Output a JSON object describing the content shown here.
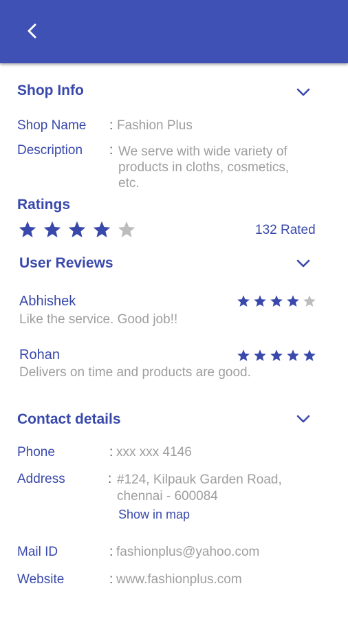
{
  "colors": {
    "primary": "#3f51b5",
    "label": "#3949ab",
    "value_gray": "#9e9e9e",
    "star_filled": "#3949ab",
    "star_empty": "#bdbdbd"
  },
  "icons": {
    "back": "chevron-left-icon",
    "collapse": "chevron-down-icon",
    "star": "star-icon"
  },
  "shop_info": {
    "title": "Shop Info",
    "shop_name_label": "Shop Name",
    "shop_name_value": "Fashion Plus",
    "description_label": "Description",
    "description_value": "We serve with wide variety of products in cloths, cosmetics, etc."
  },
  "ratings": {
    "title": "Ratings",
    "stars": 4,
    "max_stars": 5,
    "rated_text": "132 Rated"
  },
  "user_reviews": {
    "title": "User Reviews",
    "reviews": [
      {
        "name": "Abhishek",
        "text": "Like the service. Good job!!",
        "stars": 4,
        "max_stars": 5
      },
      {
        "name": "Rohan",
        "text": "Delivers on time and products are good.",
        "stars": 5,
        "max_stars": 5
      }
    ]
  },
  "contact": {
    "title": "Contact details",
    "phone_label": "Phone",
    "phone_value": "xxx xxx 4146",
    "address_label": "Address",
    "address_line1": "#124, Kilpauk Garden Road,",
    "address_line2": "chennai - 600084",
    "show_in_map": "Show in map",
    "mail_label": "Mail ID",
    "mail_value": "fashionplus@yahoo.com",
    "website_label": "Website",
    "website_value": "www.fashionplus.com"
  },
  "colon": ":"
}
